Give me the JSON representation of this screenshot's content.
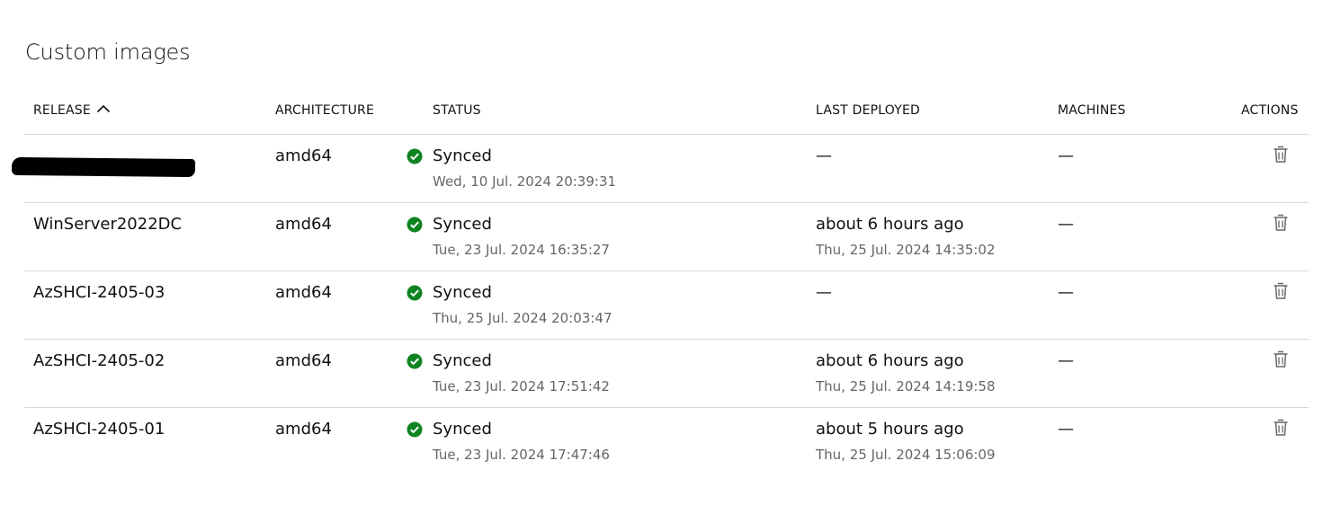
{
  "page": {
    "title": "Custom images"
  },
  "table": {
    "headers": {
      "release": "Release",
      "architecture": "Architecture",
      "status": "Status",
      "last_deployed": "Last deployed",
      "machines": "Machines",
      "actions": "Actions"
    },
    "sort": {
      "column": "release",
      "direction": "ascending",
      "icon": "chevron-up-icon"
    },
    "rows": [
      {
        "release": "",
        "release_redacted": true,
        "architecture": "amd64",
        "status": "Synced",
        "status_time": "Wed, 10 Jul. 2024 20:39:31",
        "last_deployed": "—",
        "last_deployed_time": "",
        "machines": "—",
        "action_icon": "trash-icon"
      },
      {
        "release": "WinServer2022DC",
        "architecture": "amd64",
        "status": "Synced",
        "status_time": "Tue, 23 Jul. 2024 16:35:27",
        "last_deployed": "about 6 hours ago",
        "last_deployed_time": "Thu, 25 Jul. 2024 14:35:02",
        "machines": "—",
        "action_icon": "trash-icon"
      },
      {
        "release": "AzSHCI-2405-03",
        "architecture": "amd64",
        "status": "Synced",
        "status_time": "Thu, 25 Jul. 2024 20:03:47",
        "last_deployed": "—",
        "last_deployed_time": "",
        "machines": "—",
        "action_icon": "trash-icon"
      },
      {
        "release": "AzSHCI-2405-02",
        "architecture": "amd64",
        "status": "Synced",
        "status_time": "Tue, 23 Jul. 2024 17:51:42",
        "last_deployed": "about 6 hours ago",
        "last_deployed_time": "Thu, 25 Jul. 2024 14:19:58",
        "machines": "—",
        "action_icon": "trash-icon"
      },
      {
        "release": "AzSHCI-2405-01",
        "architecture": "amd64",
        "status": "Synced",
        "status_time": "Tue, 23 Jul. 2024 17:47:46",
        "last_deployed": "about 5 hours ago",
        "last_deployed_time": "Thu, 25 Jul. 2024 15:06:09",
        "machines": "—",
        "action_icon": "trash-icon"
      }
    ]
  },
  "colors": {
    "text": "#111111",
    "muted": "#666666",
    "divider": "#d9d9d9",
    "status_success": "#0e8420",
    "icon": "#666666"
  }
}
